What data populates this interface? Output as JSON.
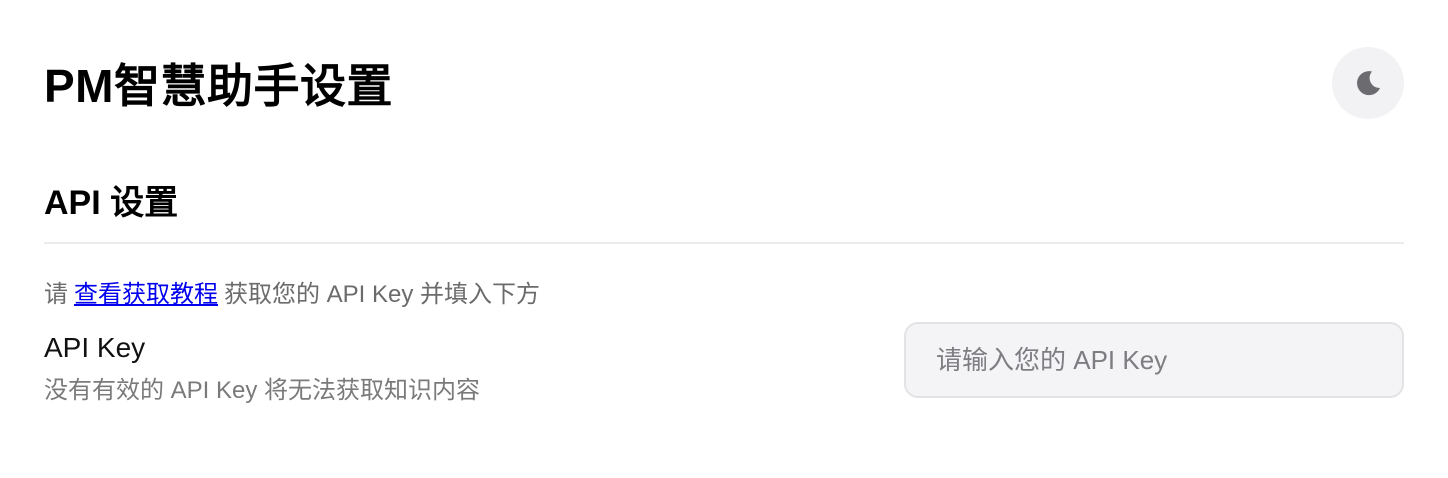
{
  "header": {
    "title": "PM智慧助手设置",
    "theme_toggle_icon": "moon-icon"
  },
  "api_section": {
    "title": "API 设置",
    "hint_prefix": "请",
    "hint_link": "查看获取教程",
    "hint_suffix": "获取您的 API Key 并填入下方",
    "field_label": "API Key",
    "field_desc": "没有有效的 API Key 将无法获取知识内容",
    "input_placeholder": "请输入您的 API Key",
    "input_value": ""
  },
  "colors": {
    "link": "#0000ee",
    "toggle_bg": "#f2f2f4",
    "input_bg": "#f4f4f6"
  }
}
